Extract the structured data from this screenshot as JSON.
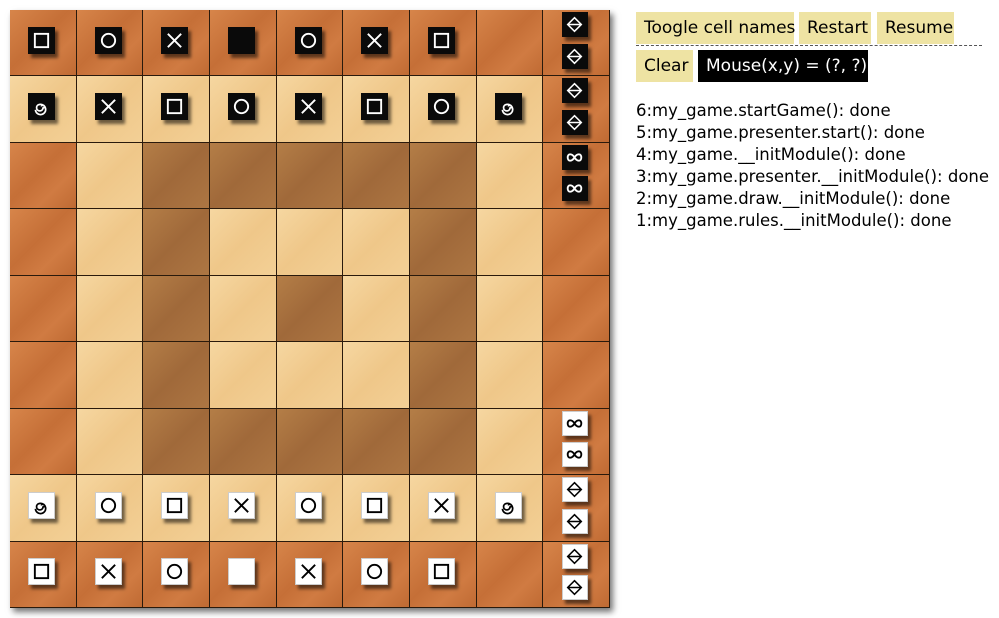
{
  "toolbar": {
    "toggle_label": "Toogle cell names",
    "restart_label": "Restart",
    "resume_label": "Resume",
    "clear_label": "Clear"
  },
  "mouse_readout": "Mouse(x,y) = (?, ?)",
  "log": [
    "6:my_game.startGame(): done",
    "5:my_game.presenter.start(): done",
    "4:my_game.__initModule(): done",
    "3:my_game.presenter.__initModule(): done",
    "2:my_game.draw.__initModule(): done",
    "1:my_game.rules.__initModule(): done"
  ],
  "board": {
    "columns": 9,
    "rows": 9,
    "cell_types": [
      "eeeeeeeee",
      "lllllllle",
      "eldddddle",
      "eldllldle",
      "eldldldle",
      "eldllldle",
      "eldddddle",
      "lllllllle",
      "eeeeeeeee"
    ],
    "colors": {
      "edge": "#c9793f",
      "light": "#f2cc90",
      "dark": "#a86f3f",
      "black_piece": "#0a0a0a",
      "white_piece": "#ffffff"
    }
  },
  "pieces": [
    {
      "color": "black",
      "shape": "square-icon",
      "row": 0,
      "col": 0
    },
    {
      "color": "black",
      "shape": "circle-icon",
      "row": 0,
      "col": 1
    },
    {
      "color": "black",
      "shape": "cross-icon",
      "row": 0,
      "col": 2
    },
    {
      "color": "black",
      "shape": "filled-square-icon",
      "row": 0,
      "col": 3
    },
    {
      "color": "black",
      "shape": "circle-icon",
      "row": 0,
      "col": 4
    },
    {
      "color": "black",
      "shape": "cross-icon",
      "row": 0,
      "col": 5
    },
    {
      "color": "black",
      "shape": "square-icon",
      "row": 0,
      "col": 6
    },
    {
      "color": "black",
      "shape": "spiral-icon",
      "row": 1,
      "col": 0
    },
    {
      "color": "black",
      "shape": "cross-icon",
      "row": 1,
      "col": 1
    },
    {
      "color": "black",
      "shape": "square-icon",
      "row": 1,
      "col": 2
    },
    {
      "color": "black",
      "shape": "circle-icon",
      "row": 1,
      "col": 3
    },
    {
      "color": "black",
      "shape": "cross-icon",
      "row": 1,
      "col": 4
    },
    {
      "color": "black",
      "shape": "square-icon",
      "row": 1,
      "col": 5
    },
    {
      "color": "black",
      "shape": "circle-icon",
      "row": 1,
      "col": 6
    },
    {
      "color": "black",
      "shape": "spiral-icon",
      "row": 1,
      "col": 7
    },
    {
      "color": "white",
      "shape": "spiral-icon",
      "row": 7,
      "col": 0
    },
    {
      "color": "white",
      "shape": "circle-icon",
      "row": 7,
      "col": 1
    },
    {
      "color": "white",
      "shape": "square-icon",
      "row": 7,
      "col": 2
    },
    {
      "color": "white",
      "shape": "cross-icon",
      "row": 7,
      "col": 3
    },
    {
      "color": "white",
      "shape": "circle-icon",
      "row": 7,
      "col": 4
    },
    {
      "color": "white",
      "shape": "square-icon",
      "row": 7,
      "col": 5
    },
    {
      "color": "white",
      "shape": "cross-icon",
      "row": 7,
      "col": 6
    },
    {
      "color": "white",
      "shape": "spiral-icon",
      "row": 7,
      "col": 7
    },
    {
      "color": "white",
      "shape": "square-icon",
      "row": 8,
      "col": 0
    },
    {
      "color": "white",
      "shape": "cross-icon",
      "row": 8,
      "col": 1
    },
    {
      "color": "white",
      "shape": "circle-icon",
      "row": 8,
      "col": 2
    },
    {
      "color": "white",
      "shape": "filled-square-icon",
      "row": 8,
      "col": 3
    },
    {
      "color": "white",
      "shape": "cross-icon",
      "row": 8,
      "col": 4
    },
    {
      "color": "white",
      "shape": "circle-icon",
      "row": 8,
      "col": 5
    },
    {
      "color": "white",
      "shape": "square-icon",
      "row": 8,
      "col": 6
    }
  ],
  "reserve": [
    {
      "color": "black",
      "shape": "diamond-cross-icon",
      "row": 0,
      "slot": 0
    },
    {
      "color": "black",
      "shape": "diamond-cross-icon",
      "row": 0,
      "slot": 1
    },
    {
      "color": "black",
      "shape": "diamond-cross-icon",
      "row": 1,
      "slot": 0
    },
    {
      "color": "black",
      "shape": "diamond-cross-icon",
      "row": 1,
      "slot": 1
    },
    {
      "color": "black",
      "shape": "infinity-icon",
      "row": 2,
      "slot": 0
    },
    {
      "color": "black",
      "shape": "infinity-icon",
      "row": 2,
      "slot": 1
    },
    {
      "color": "white",
      "shape": "infinity-icon",
      "row": 6,
      "slot": 0
    },
    {
      "color": "white",
      "shape": "infinity-icon",
      "row": 6,
      "slot": 1
    },
    {
      "color": "white",
      "shape": "diamond-cross-icon",
      "row": 7,
      "slot": 0
    },
    {
      "color": "white",
      "shape": "diamond-cross-icon",
      "row": 7,
      "slot": 1
    },
    {
      "color": "white",
      "shape": "diamond-cross-icon",
      "row": 8,
      "slot": 0
    },
    {
      "color": "white",
      "shape": "diamond-cross-icon",
      "row": 8,
      "slot": 1
    }
  ]
}
